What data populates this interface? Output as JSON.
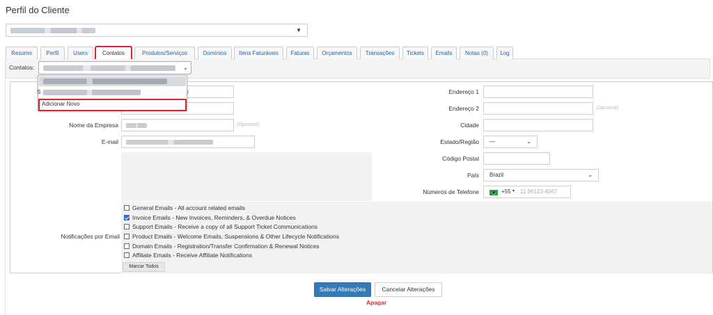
{
  "page": {
    "title": "Perfil do Cliente"
  },
  "tabs": [
    {
      "label": "Resumo"
    },
    {
      "label": "Perfil"
    },
    {
      "label": "Users"
    },
    {
      "label": "Contatos",
      "active": true
    },
    {
      "label": "Produtos/Serviços"
    },
    {
      "label": "Domínios"
    },
    {
      "label": "Itens Faturáveis"
    },
    {
      "label": "Faturas"
    },
    {
      "label": "Orçamentos"
    },
    {
      "label": "Transações"
    },
    {
      "label": "Tickets"
    },
    {
      "label": "Emails"
    },
    {
      "label": "Notas (0)"
    },
    {
      "label": "Log"
    }
  ],
  "contacts": {
    "label": "Contatos:",
    "dropdown_prefix": "S",
    "add_new": "Adicionar Novo"
  },
  "form": {
    "company_label": "Nome da Empresa",
    "email_label": "E-mail",
    "optional": "(Opcional)",
    "address1_label": "Endereço 1",
    "address2_label": "Endereço 2",
    "city_label": "Cidade",
    "state_label": "Estado/Região",
    "state_value": "—",
    "postcode_label": "Código Postal",
    "country_label": "País",
    "country_value": "Brazil",
    "phone_label": "Números de Telefone",
    "phone_code": "+55",
    "phone_placeholder": "11 96123-4567"
  },
  "notifications": {
    "label": "Notificações por Email",
    "items": [
      {
        "text": "General Emails - All account related emails",
        "checked": false
      },
      {
        "text": "Invoice Emails - New Invoices, Reminders, & Overdue Notices",
        "checked": true
      },
      {
        "text": "Support Emails - Receive a copy of all Support Ticket Communications",
        "checked": false
      },
      {
        "text": "Product Emails - Welcome Emails, Suspensions & Other Lifecycle Notifications",
        "checked": false
      },
      {
        "text": "Domain Emails - Registration/Transfer Confirmation & Renewal Notices",
        "checked": false
      },
      {
        "text": "Affiliate Emails - Receive Affiliate Notifications",
        "checked": false
      }
    ],
    "select_all": "Marcar Todos"
  },
  "actions": {
    "save": "Salvar Alterações",
    "cancel": "Cancelar Alterações",
    "delete": "Apagar"
  },
  "colors": {
    "primary": "#337ab7",
    "highlight": "#d9232d",
    "danger": "#c9302c"
  }
}
